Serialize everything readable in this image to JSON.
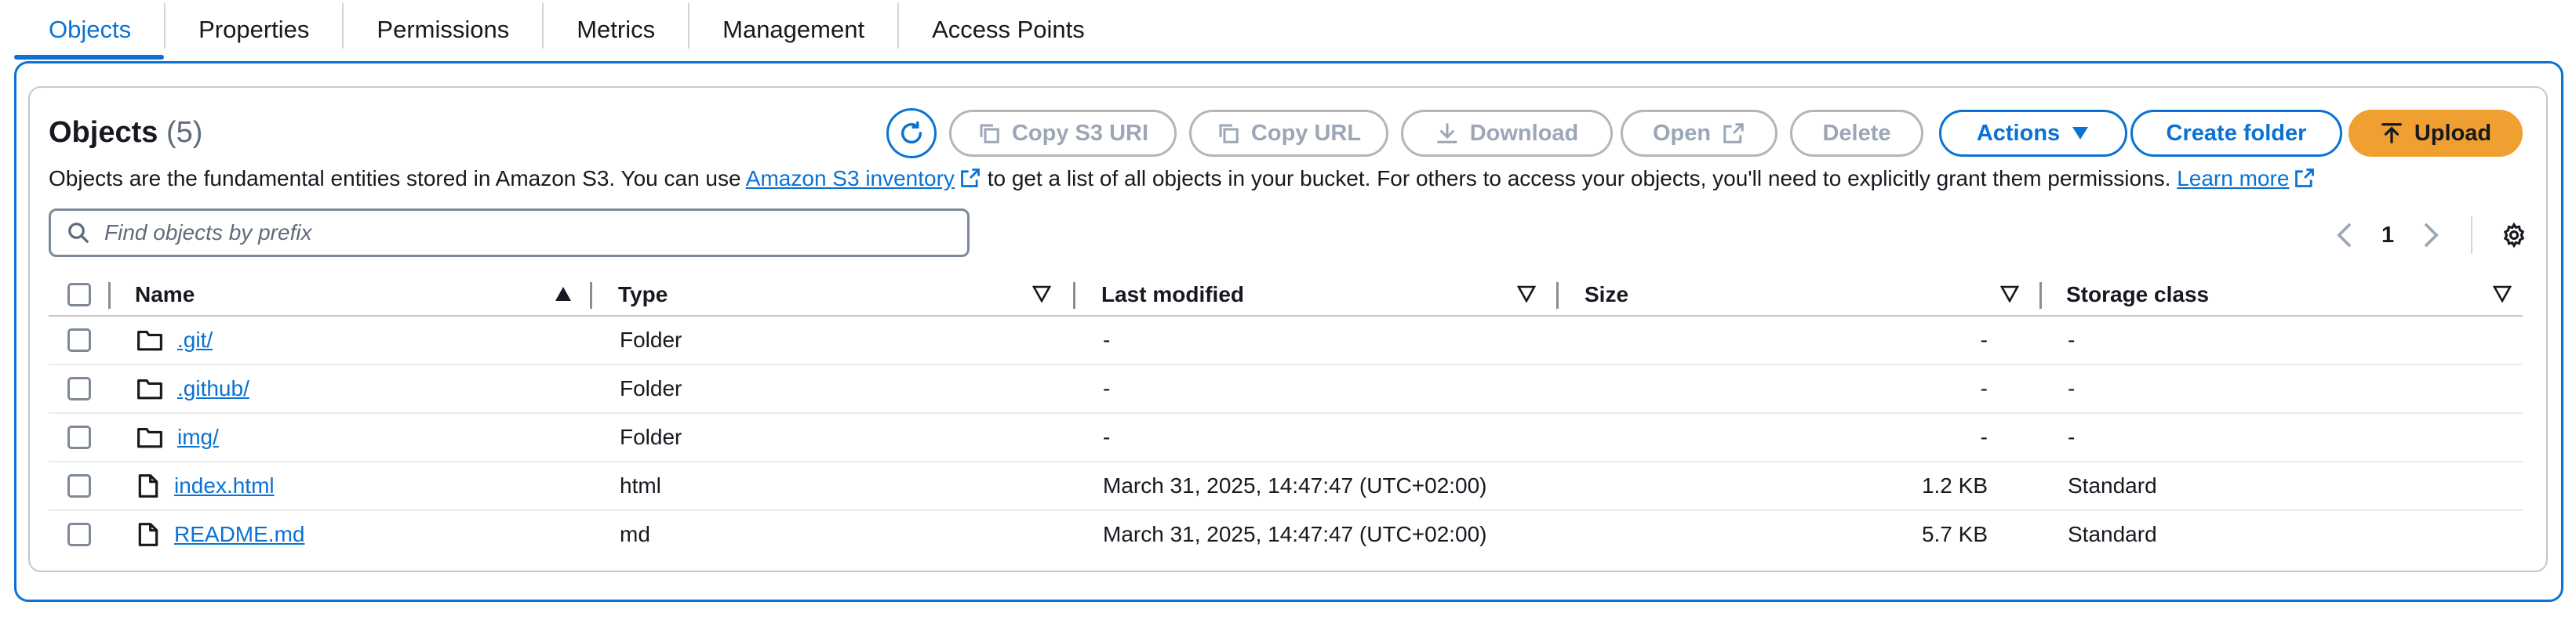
{
  "tabs": [
    "Objects",
    "Properties",
    "Permissions",
    "Metrics",
    "Management",
    "Access Points"
  ],
  "header": {
    "title": "Objects",
    "count": "(5)"
  },
  "actions": {
    "copy_s3_uri": "Copy S3 URI",
    "copy_url": "Copy URL",
    "download": "Download",
    "open": "Open",
    "delete": "Delete",
    "actions": "Actions",
    "create_folder": "Create folder",
    "upload": "Upload"
  },
  "description": {
    "part1": "Objects are the fundamental entities stored in Amazon S3. You can use",
    "link1": "Amazon S3 inventory",
    "part2": "to get a list of all objects in your bucket. For others to access your objects, you'll need to explicitly grant them permissions.",
    "link2": "Learn more"
  },
  "search": {
    "placeholder": "Find objects by prefix",
    "value": ""
  },
  "pagination": {
    "current": "1"
  },
  "table": {
    "columns": [
      "Name",
      "Type",
      "Last modified",
      "Size",
      "Storage class"
    ],
    "rows": [
      {
        "icon": "folder-icon",
        "name": ".git/",
        "type": "Folder",
        "modified": "-",
        "size": "-",
        "storage": "-"
      },
      {
        "icon": "folder-icon",
        "name": ".github/",
        "type": "Folder",
        "modified": "-",
        "size": "-",
        "storage": "-"
      },
      {
        "icon": "folder-icon",
        "name": "img/",
        "type": "Folder",
        "modified": "-",
        "size": "-",
        "storage": "-"
      },
      {
        "icon": "file-icon",
        "name": "index.html",
        "type": "html",
        "modified": "March 31, 2025, 14:47:47 (UTC+02:00)",
        "size": "1.2 KB",
        "storage": "Standard"
      },
      {
        "icon": "file-icon",
        "name": "README.md",
        "type": "md",
        "modified": "March 31, 2025, 14:47:47 (UTC+02:00)",
        "size": "5.7 KB",
        "storage": "Standard"
      }
    ]
  },
  "colors": {
    "accent": "#0972d3",
    "upload": "#f0a030",
    "disabled": "#9ba7b6"
  }
}
